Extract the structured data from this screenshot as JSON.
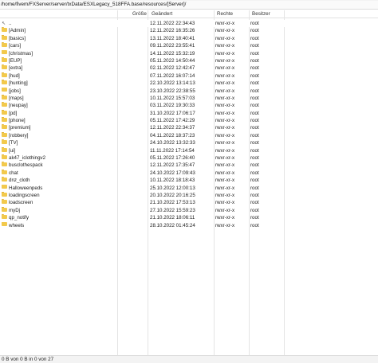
{
  "path": {
    "value": "/home/fivem/FXServer/server/txData/ESXLegacy_518FFA.base/resources/[Server]/"
  },
  "columns": {
    "size": "Größe",
    "modified": "Geändert",
    "permissions": "Rechte",
    "owner": "Besitzer"
  },
  "parent": {
    "label": "..",
    "date": "12.11.2022 22:34:43",
    "permissions": "rwxr-xr-x",
    "owner": "root"
  },
  "files": [
    {
      "name": "[Admin]",
      "date": "12.11.2022 16:35:26",
      "permissions": "rwxr-xr-x",
      "owner": "root"
    },
    {
      "name": "[basics]",
      "date": "13.11.2022 18:40:41",
      "permissions": "rwxr-xr-x",
      "owner": "root"
    },
    {
      "name": "[cars]",
      "date": "09.11.2022 23:55:41",
      "permissions": "rwxr-xr-x",
      "owner": "root"
    },
    {
      "name": "[christmas]",
      "date": "14.11.2022 15:32:19",
      "permissions": "rwxr-xr-x",
      "owner": "root"
    },
    {
      "name": "[EUP]",
      "date": "05.11.2022 14:50:44",
      "permissions": "rwxr-xr-x",
      "owner": "root"
    },
    {
      "name": "[extra]",
      "date": "02.11.2022 12:42:47",
      "permissions": "rwxr-xr-x",
      "owner": "root"
    },
    {
      "name": "[hud]",
      "date": "07.11.2022 16:07:14",
      "permissions": "rwxr-xr-x",
      "owner": "root"
    },
    {
      "name": "[hunting]",
      "date": "22.10.2022 13:14:13",
      "permissions": "rwxr-xr-x",
      "owner": "root"
    },
    {
      "name": "[jobs]",
      "date": "23.10.2022 22:38:55",
      "permissions": "rwxr-xr-x",
      "owner": "root"
    },
    {
      "name": "[maps]",
      "date": "10.11.2022 15:57:03",
      "permissions": "rwxr-xr-x",
      "owner": "root"
    },
    {
      "name": "[neupay]",
      "date": "03.11.2022 19:30:33",
      "permissions": "rwxr-xr-x",
      "owner": "root"
    },
    {
      "name": "[pd]",
      "date": "31.10.2022 17:06:17",
      "permissions": "rwxr-xr-x",
      "owner": "root"
    },
    {
      "name": "[phone]",
      "date": "05.11.2022 17:42:29",
      "permissions": "rwxr-xr-x",
      "owner": "root"
    },
    {
      "name": "[premium]",
      "date": "12.11.2022 22:34:37",
      "permissions": "rwxr-xr-x",
      "owner": "root"
    },
    {
      "name": "[robbery]",
      "date": "04.11.2022 18:37:23",
      "permissions": "rwxr-xr-x",
      "owner": "root"
    },
    {
      "name": "[TV]",
      "date": "24.10.2022 13:32:33",
      "permissions": "rwxr-xr-x",
      "owner": "root"
    },
    {
      "name": "[ui]",
      "date": "11.11.2022 17:14:54",
      "permissions": "rwxr-xr-x",
      "owner": "root"
    },
    {
      "name": "ak47_iclothingv2",
      "date": "05.11.2022 17:26:40",
      "permissions": "rwxr-xr-x",
      "owner": "root"
    },
    {
      "name": "busclothespack",
      "date": "12.11.2022 17:35:47",
      "permissions": "rwxr-xr-x",
      "owner": "root"
    },
    {
      "name": "chat",
      "date": "24.10.2022 17:09:43",
      "permissions": "rwxr-xr-x",
      "owner": "root"
    },
    {
      "name": "dnz_cloth",
      "date": "10.11.2022 18:18:43",
      "permissions": "rwxr-xr-x",
      "owner": "root"
    },
    {
      "name": "Halloweenpeds",
      "date": "25.10.2022 12:00:13",
      "permissions": "rwxr-xr-x",
      "owner": "root"
    },
    {
      "name": "loadingscreen",
      "date": "20.10.2022 20:16:25",
      "permissions": "rwxr-xr-x",
      "owner": "root"
    },
    {
      "name": "loadscreen",
      "date": "21.10.2022 17:53:13",
      "permissions": "rwxr-xr-x",
      "owner": "root"
    },
    {
      "name": "myDj",
      "date": "27.10.2022 15:59:23",
      "permissions": "rwxr-xr-x",
      "owner": "root"
    },
    {
      "name": "qp_notify",
      "date": "21.10.2022 18:06:11",
      "permissions": "rwxr-xr-x",
      "owner": "root"
    },
    {
      "name": "wheels",
      "date": "28.10.2022 01:45:24",
      "permissions": "rwxr-xr-x",
      "owner": "root"
    }
  ],
  "status": {
    "text": "0 B von 0 B in 0 von 27"
  },
  "icons": {
    "folder": "folder-icon",
    "parent": "parent-directory-icon"
  },
  "colors": {
    "folder": "#f2c94c"
  }
}
